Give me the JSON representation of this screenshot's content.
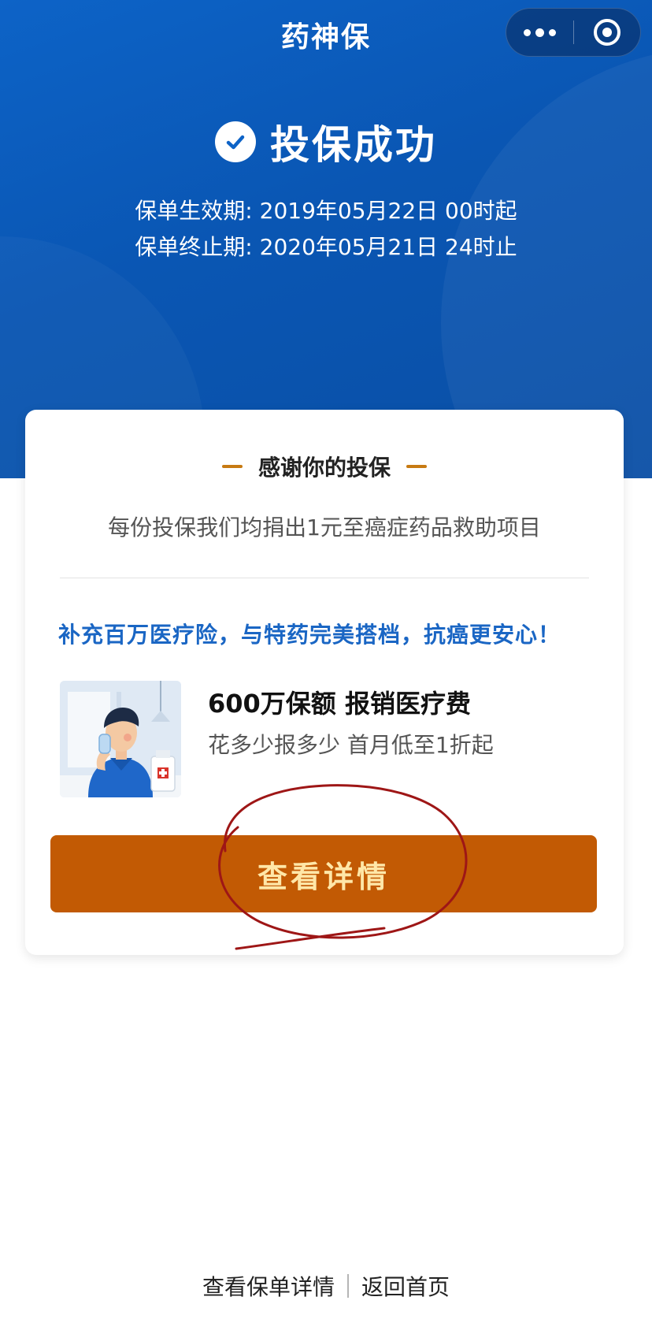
{
  "nav": {
    "title": "药神保"
  },
  "success": {
    "title": "投保成功"
  },
  "policy": {
    "start": "保单生效期: 2019年05月22日 00时起",
    "end": "保单终止期: 2020年05月21日 24时止"
  },
  "card": {
    "thanks_title": "感谢你的投保",
    "donate_text": "每份投保我们均捐出1元至癌症药品救助项目",
    "promo_slogan": "补充百万医疗险，与特药完美搭档，抗癌更安心！",
    "product_title": "600万保额 报销医疗费",
    "product_sub": "花多少报多少 首月低至1折起",
    "detail_button": "查看详情"
  },
  "bottom": {
    "policy_detail_link": "查看保单详情",
    "home_link": "返回首页"
  },
  "colors": {
    "brand_blue": "#0d63c7",
    "button_orange": "#c25a04",
    "button_text": "#ffe7a8",
    "slogan_blue": "#1a66c4",
    "annotation_red": "#9e1616"
  },
  "icons": {
    "success": "check-circle-icon",
    "more": "more-dots-icon",
    "close": "capsule-close-icon"
  }
}
